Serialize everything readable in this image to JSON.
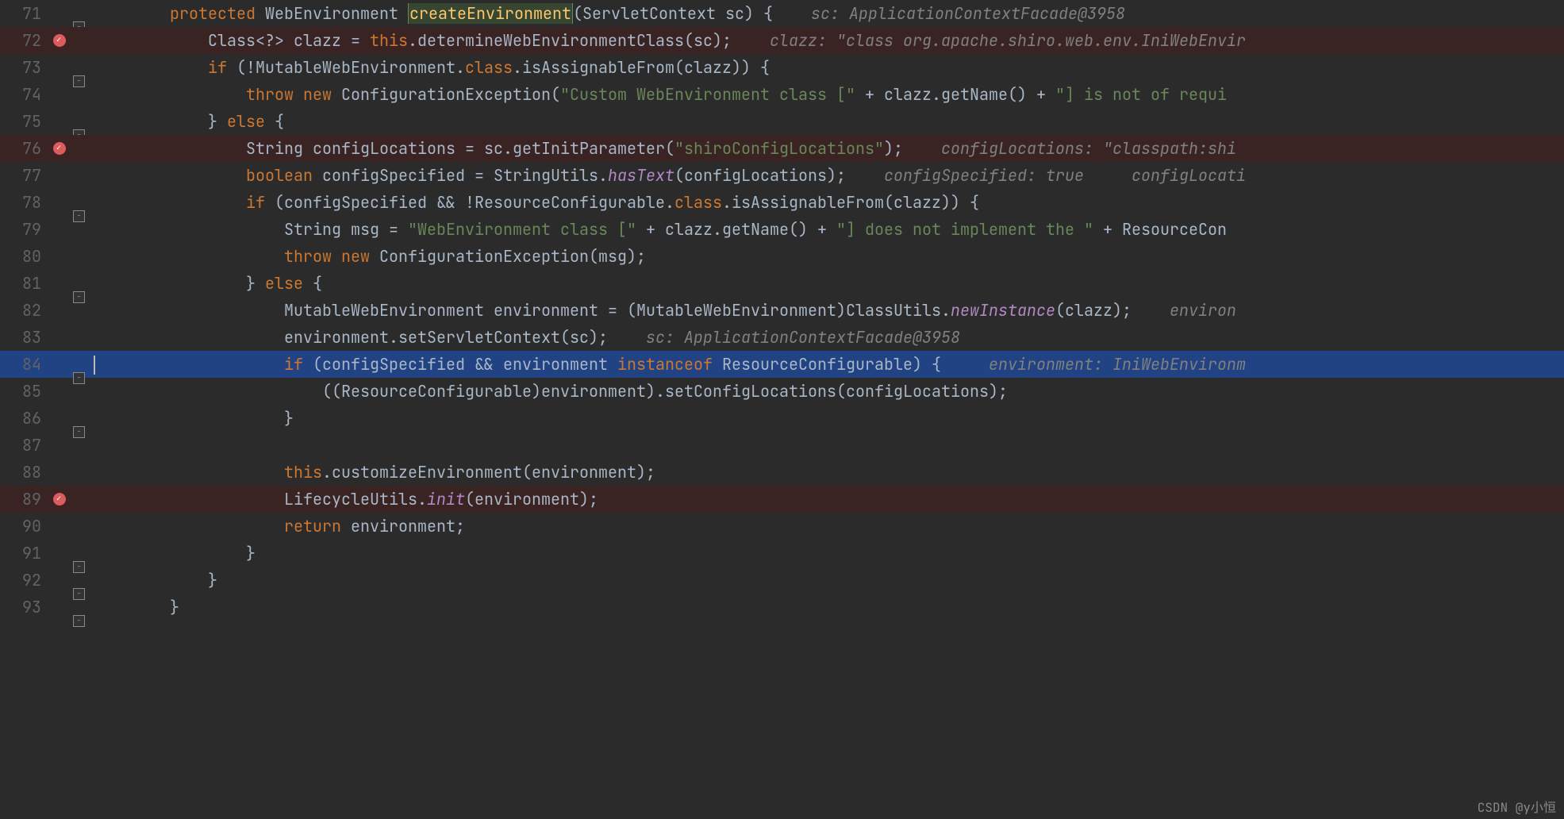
{
  "watermark": "CSDN @y小恒",
  "lines": [
    {
      "n": 71,
      "bp": false,
      "cur": false,
      "fold": "open",
      "segs": [
        {
          "t": "        ",
          "c": ""
        },
        {
          "t": "protected ",
          "c": "kw"
        },
        {
          "t": "WebEnvironment ",
          "c": ""
        },
        {
          "t": "createEnvironment",
          "c": "fn box"
        },
        {
          "t": "(ServletContext sc) {    ",
          "c": ""
        },
        {
          "t": "sc: ApplicationContextFacade@3958",
          "c": "cmt"
        }
      ]
    },
    {
      "n": 72,
      "bp": true,
      "cur": false,
      "fold": "",
      "segs": [
        {
          "t": "            Class<?> clazz = ",
          "c": ""
        },
        {
          "t": "this",
          "c": "kw"
        },
        {
          "t": ".determineWebEnvironmentClass(sc);    ",
          "c": ""
        },
        {
          "t": "clazz: \"class org.apache.shiro.web.env.IniWebEnvir",
          "c": "cmt"
        }
      ]
    },
    {
      "n": 73,
      "bp": false,
      "cur": false,
      "fold": "open",
      "segs": [
        {
          "t": "            ",
          "c": ""
        },
        {
          "t": "if ",
          "c": "kw"
        },
        {
          "t": "(!MutableWebEnvironment.",
          "c": ""
        },
        {
          "t": "class",
          "c": "kw"
        },
        {
          "t": ".isAssignableFrom(clazz)) {",
          "c": ""
        }
      ]
    },
    {
      "n": 74,
      "bp": false,
      "cur": false,
      "fold": "",
      "segs": [
        {
          "t": "                ",
          "c": ""
        },
        {
          "t": "throw new ",
          "c": "kw"
        },
        {
          "t": "ConfigurationException(",
          "c": ""
        },
        {
          "t": "\"Custom WebEnvironment class [\"",
          "c": "str"
        },
        {
          "t": " + clazz.getName() + ",
          "c": ""
        },
        {
          "t": "\"] is not of requi",
          "c": "str"
        }
      ]
    },
    {
      "n": 75,
      "bp": false,
      "cur": false,
      "fold": "close-open",
      "segs": [
        {
          "t": "            } ",
          "c": ""
        },
        {
          "t": "else ",
          "c": "kw"
        },
        {
          "t": "{",
          "c": ""
        }
      ]
    },
    {
      "n": 76,
      "bp": true,
      "cur": false,
      "fold": "",
      "segs": [
        {
          "t": "                String configLocations = sc.getInitParameter(",
          "c": ""
        },
        {
          "t": "\"shiroConfigLocations\"",
          "c": "str"
        },
        {
          "t": ");    ",
          "c": ""
        },
        {
          "t": "configLocations: \"classpath:shi",
          "c": "cmt"
        }
      ]
    },
    {
      "n": 77,
      "bp": false,
      "cur": false,
      "fold": "",
      "segs": [
        {
          "t": "                ",
          "c": ""
        },
        {
          "t": "boolean ",
          "c": "kw"
        },
        {
          "t": "configSpecified = StringUtils.",
          "c": ""
        },
        {
          "t": "hasText",
          "c": "it"
        },
        {
          "t": "(configLocations);    ",
          "c": ""
        },
        {
          "t": "configSpecified: true     configLocati",
          "c": "cmt"
        }
      ]
    },
    {
      "n": 78,
      "bp": false,
      "cur": false,
      "fold": "open",
      "segs": [
        {
          "t": "                ",
          "c": ""
        },
        {
          "t": "if ",
          "c": "kw"
        },
        {
          "t": "(configSpecified && !ResourceConfigurable.",
          "c": ""
        },
        {
          "t": "class",
          "c": "kw"
        },
        {
          "t": ".isAssignableFrom(clazz)) {",
          "c": ""
        }
      ]
    },
    {
      "n": 79,
      "bp": false,
      "cur": false,
      "fold": "",
      "segs": [
        {
          "t": "                    String msg = ",
          "c": ""
        },
        {
          "t": "\"WebEnvironment class [\"",
          "c": "str"
        },
        {
          "t": " + clazz.getName() + ",
          "c": ""
        },
        {
          "t": "\"] does not implement the \"",
          "c": "str"
        },
        {
          "t": " + ResourceCon",
          "c": ""
        }
      ]
    },
    {
      "n": 80,
      "bp": false,
      "cur": false,
      "fold": "",
      "segs": [
        {
          "t": "                    ",
          "c": ""
        },
        {
          "t": "throw new ",
          "c": "kw"
        },
        {
          "t": "ConfigurationException(msg);",
          "c": ""
        }
      ]
    },
    {
      "n": 81,
      "bp": false,
      "cur": false,
      "fold": "close-open",
      "segs": [
        {
          "t": "                } ",
          "c": ""
        },
        {
          "t": "else ",
          "c": "kw"
        },
        {
          "t": "{",
          "c": ""
        }
      ]
    },
    {
      "n": 82,
      "bp": false,
      "cur": false,
      "fold": "",
      "segs": [
        {
          "t": "                    MutableWebEnvironment environment = (MutableWebEnvironment)ClassUtils.",
          "c": ""
        },
        {
          "t": "newInstance",
          "c": "it"
        },
        {
          "t": "(clazz);    ",
          "c": ""
        },
        {
          "t": "environ",
          "c": "cmt"
        }
      ]
    },
    {
      "n": 83,
      "bp": false,
      "cur": false,
      "fold": "",
      "segs": [
        {
          "t": "                    environment.setServletContext(sc);    ",
          "c": ""
        },
        {
          "t": "sc: ApplicationContextFacade@3958",
          "c": "cmt"
        }
      ]
    },
    {
      "n": 84,
      "bp": false,
      "cur": true,
      "fold": "open",
      "segs": [
        {
          "t": "                    ",
          "c": ""
        },
        {
          "t": "if ",
          "c": "kw"
        },
        {
          "t": "(configSpecified && environment ",
          "c": ""
        },
        {
          "t": "instanceof ",
          "c": "kw"
        },
        {
          "t": "ResourceConfigurable) {     ",
          "c": ""
        },
        {
          "t": "environment: IniWebEnvironm",
          "c": "cmt"
        }
      ]
    },
    {
      "n": 85,
      "bp": false,
      "cur": false,
      "fold": "",
      "segs": [
        {
          "t": "                        ((ResourceConfigurable)environment).setConfigLocations(configLocations);",
          "c": ""
        }
      ]
    },
    {
      "n": 86,
      "bp": false,
      "cur": false,
      "fold": "close",
      "segs": [
        {
          "t": "                    }",
          "c": ""
        }
      ]
    },
    {
      "n": 87,
      "bp": false,
      "cur": false,
      "fold": "",
      "segs": [
        {
          "t": "",
          "c": ""
        }
      ]
    },
    {
      "n": 88,
      "bp": false,
      "cur": false,
      "fold": "",
      "segs": [
        {
          "t": "                    ",
          "c": ""
        },
        {
          "t": "this",
          "c": "kw"
        },
        {
          "t": ".customizeEnvironment(environment);",
          "c": ""
        }
      ]
    },
    {
      "n": 89,
      "bp": true,
      "cur": false,
      "fold": "",
      "segs": [
        {
          "t": "                    LifecycleUtils.",
          "c": ""
        },
        {
          "t": "init",
          "c": "it"
        },
        {
          "t": "(environment);",
          "c": ""
        }
      ]
    },
    {
      "n": 90,
      "bp": false,
      "cur": false,
      "fold": "",
      "segs": [
        {
          "t": "                    ",
          "c": ""
        },
        {
          "t": "return ",
          "c": "kw"
        },
        {
          "t": "environment;",
          "c": ""
        }
      ]
    },
    {
      "n": 91,
      "bp": false,
      "cur": false,
      "fold": "close",
      "segs": [
        {
          "t": "                }",
          "c": ""
        }
      ]
    },
    {
      "n": 92,
      "bp": false,
      "cur": false,
      "fold": "close",
      "segs": [
        {
          "t": "            }",
          "c": ""
        }
      ]
    },
    {
      "n": 93,
      "bp": false,
      "cur": false,
      "fold": "close",
      "segs": [
        {
          "t": "        }",
          "c": ""
        }
      ]
    }
  ]
}
